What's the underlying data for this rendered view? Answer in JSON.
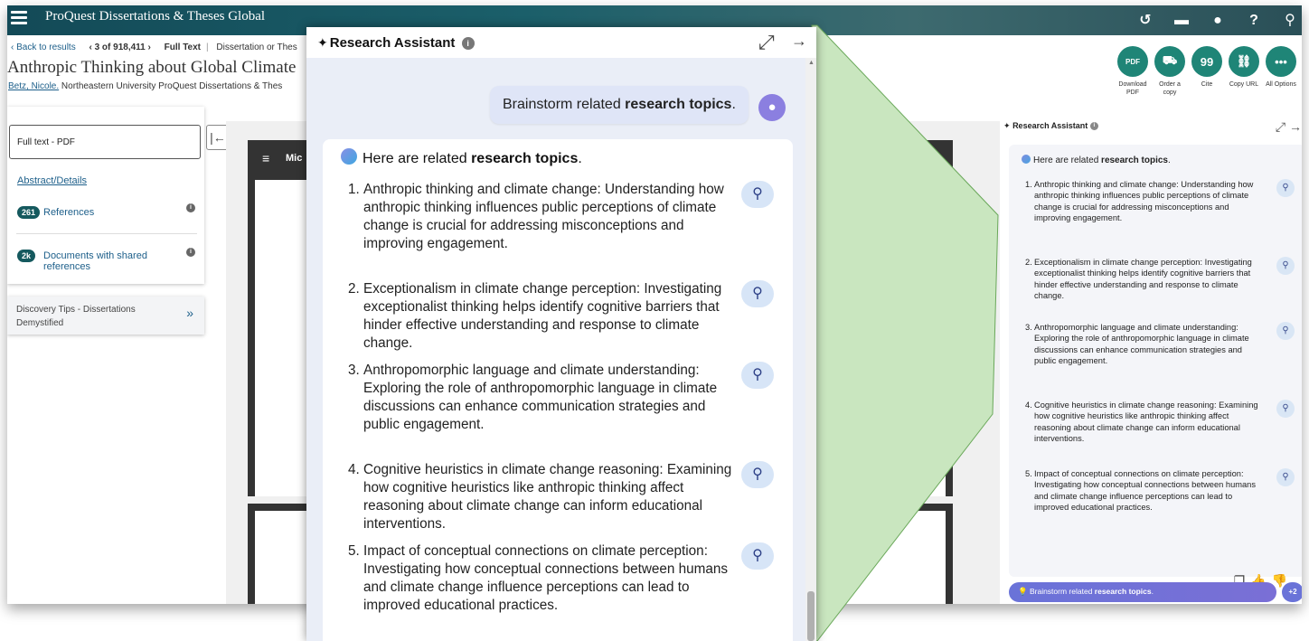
{
  "proquest": {
    "brand": "ProQuest Dissertations & Theses Global",
    "breadcrumb": {
      "back": "‹ Back to results",
      "position": "‹ 3 of 918,411 ›",
      "full_text": "Full Text",
      "doc_type": "Dissertation or Thes"
    },
    "title": "Anthropic Thinking about Global Climate",
    "author": "Betz, Nicole.",
    "affiliation": "Northeastern University ProQuest Dissertations & Thes",
    "actions": [
      {
        "icon": "download-pdf-icon",
        "glyph": "PDF",
        "label": "Download PDF"
      },
      {
        "icon": "cart-icon",
        "glyph": "⛟",
        "label": "Order a copy"
      },
      {
        "icon": "quote-icon",
        "glyph": "99",
        "label": "Cite"
      },
      {
        "icon": "link-icon",
        "glyph": "⛓",
        "label": "Copy URL"
      },
      {
        "icon": "more-icon",
        "glyph": "•••",
        "label": "All Options"
      }
    ],
    "sidebar": {
      "full_text_pdf": "Full text - PDF",
      "abstract": "Abstract/Details",
      "references_count": "261",
      "references_label": "References",
      "shared_count": "2k",
      "shared_label_1": "Documents with shared",
      "shared_label_2": "references"
    },
    "tips": {
      "line1": "Discovery Tips - Dissertations",
      "line2": "Demystified"
    },
    "pdf_toolbar_title": "Mic",
    "colors": {
      "topbar": "#134a57",
      "accent": "#1f8577",
      "link": "#1d5f8a"
    }
  },
  "assistant_small": {
    "title": "Research Assistant",
    "intro_prefix": "Here are related ",
    "intro_bold": "research topics",
    "intro_suffix": ".",
    "items": [
      {
        "n": "1.",
        "text": "Anthropic thinking and climate change: Understanding how anthropic thinking influences public perceptions of climate change is crucial for addressing misconceptions and improving engagement."
      },
      {
        "n": "2.",
        "text": "Exceptionalism in climate change perception: Investigating exceptionalist thinking helps identify cognitive barriers that hinder effective understanding and response to climate change."
      },
      {
        "n": "3.",
        "text": "Anthropomorphic language and climate understanding: Exploring the role of anthropomorphic language in climate discussions can enhance communication strategies and public engagement."
      },
      {
        "n": "4.",
        "text": "Cognitive heuristics in climate change reasoning: Examining how cognitive heuristics like anthropic thinking affect reasoning about climate change can inform educational interventions."
      },
      {
        "n": "5.",
        "text": "Impact of conceptual connections on climate perception: Investigating how conceptual connections between humans and climate change influence perceptions can lead to improved educational practices."
      }
    ],
    "prompt_prefix": "Brainstorm related ",
    "prompt_bold": "research topics",
    "prompt_suffix": ".",
    "more_count": "+2"
  },
  "assistant_big": {
    "title": "Research Assistant",
    "user_prefix": "Brainstorm related ",
    "user_bold": "research topics",
    "user_suffix": ".",
    "intro_prefix": "Here are related ",
    "intro_bold": "research topics",
    "intro_suffix": ".",
    "items": [
      {
        "n": "1.",
        "text": "Anthropic thinking and climate change: Understanding how anthropic thinking influences public perceptions of climate change is crucial for addressing misconceptions and improving engagement."
      },
      {
        "n": "2.",
        "text": "Exceptionalism in climate change perception: Investigating exceptionalist thinking helps identify cognitive barriers that hinder effective understanding and response to climate change."
      },
      {
        "n": "3.",
        "text": "Anthropomorphic language and climate understanding: Exploring the role of anthropomorphic language in climate discussions can enhance communication strategies and public engagement."
      },
      {
        "n": "4.",
        "text": "Cognitive heuristics in climate change reasoning: Examining how cognitive heuristics like anthropic thinking affect reasoning about climate change can inform educational interventions."
      },
      {
        "n": "5.",
        "text": "Impact of conceptual connections on climate perception: Investigating how conceptual connections between humans and climate change influence perceptions can lead to improved educational practices."
      }
    ],
    "colors": {
      "panel_bg": "#eaeef7",
      "user_bubble": "#dfe5f7",
      "search_btn": "#d7e5f7",
      "funnel": "#c9e6bf"
    }
  }
}
